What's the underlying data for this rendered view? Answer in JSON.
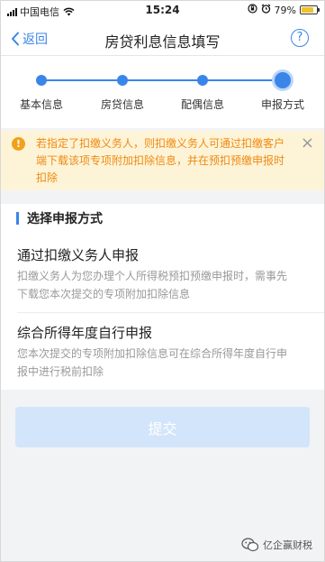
{
  "status_bar": {
    "carrier": "中国电信",
    "time": "15:24",
    "battery_percent": "79%",
    "battery_level": 0.79
  },
  "nav": {
    "back_label": "返回",
    "title": "房贷利息信息填写",
    "help_label": "?"
  },
  "steps": [
    {
      "label": "基本信息"
    },
    {
      "label": "房贷信息"
    },
    {
      "label": "配偶信息"
    },
    {
      "label": "申报方式"
    }
  ],
  "notice": {
    "icon": "!",
    "text": "若指定了扣缴义务人，则扣缴义务人可通过扣缴客户端下载该项专项附加扣除信息，并在预扣预缴申报时扣除",
    "close": "×"
  },
  "section": {
    "title": "选择申报方式",
    "options": [
      {
        "title": "通过扣缴义务人申报",
        "desc": "扣缴义务人为您办理个人所得税预扣预缴申报时，需事先下载您本次提交的专项附加扣除信息"
      },
      {
        "title": "综合所得年度自行申报",
        "desc": "您本次提交的专项附加扣除信息可在综合所得年度自行申报中进行税前扣除"
      }
    ]
  },
  "submit_label": "提交",
  "watermark": "亿企赢财税",
  "colors": {
    "accent": "#3a86e8",
    "notice_bg": "#fdf4d8",
    "notice_text": "#ef8a12",
    "submit_disabled": "#d3e5fb"
  }
}
